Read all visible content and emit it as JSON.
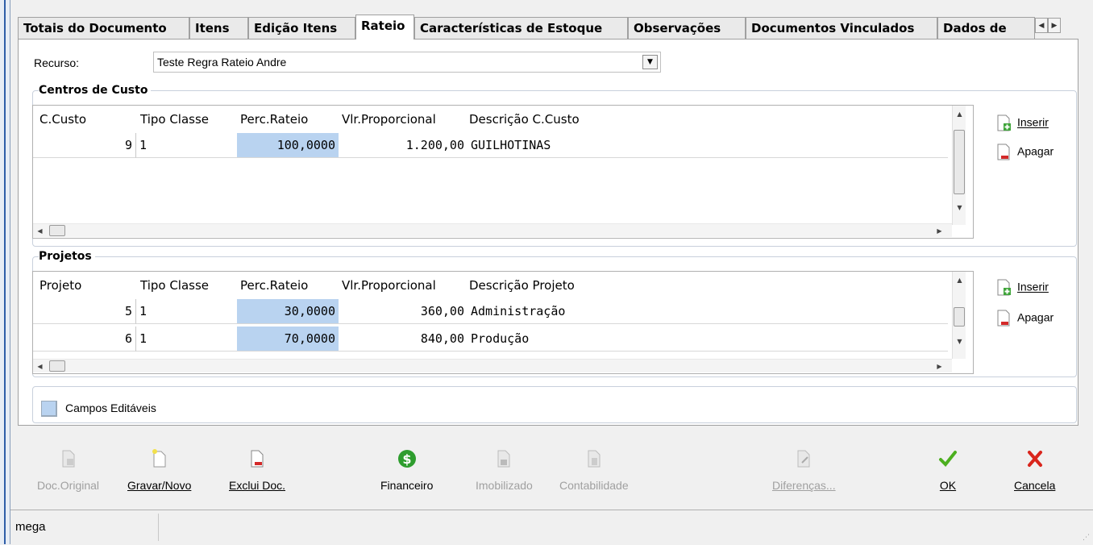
{
  "tabs": [
    {
      "label": "Totais do Documento",
      "active": false
    },
    {
      "label": "Itens",
      "active": false
    },
    {
      "label": "Edição Itens",
      "active": false
    },
    {
      "label": "Rateio",
      "active": true
    },
    {
      "label": "Características de Estoque",
      "active": false
    },
    {
      "label": "Observações",
      "active": false
    },
    {
      "label": "Documentos Vinculados",
      "active": false
    },
    {
      "label": "Dados de",
      "active": false
    }
  ],
  "recurso": {
    "label": "Recurso:",
    "value": "Teste Regra Rateio Andre"
  },
  "centros": {
    "title": "Centros de Custo",
    "columns": [
      "C.Custo",
      "Tipo Classe",
      "Perc.Rateio",
      "Vlr.Proporcional",
      "Descrição C.Custo"
    ],
    "rows": [
      {
        "code": "9",
        "tipo": "1",
        "perc": "100,0000",
        "valor": "1.200,00",
        "desc": "GUILHOTINAS"
      }
    ],
    "insert_label": "Inserir",
    "delete_label": "Apagar"
  },
  "projetos": {
    "title": "Projetos",
    "columns": [
      "Projeto",
      "Tipo Classe",
      "Perc.Rateio",
      "Vlr.Proporcional",
      "Descrição Projeto"
    ],
    "rows": [
      {
        "code": "5",
        "tipo": "1",
        "perc": "30,0000",
        "valor": "360,00",
        "desc": "Administração"
      },
      {
        "code": "6",
        "tipo": "1",
        "perc": "70,0000",
        "valor": "840,00",
        "desc": "Produção"
      }
    ],
    "insert_label": "Inserir",
    "delete_label": "Apagar"
  },
  "legend": {
    "label": "Campos Editáveis",
    "color": "#b9d3f0"
  },
  "toolbar": {
    "doc_original": "Doc.Original",
    "gravar_novo": "Gravar/Novo",
    "exclui_doc": "Exclui Doc.",
    "financeiro": "Financeiro",
    "imobilizado": "Imobilizado",
    "contabilidade": "Contabilidade",
    "diferencas": "Diferenças...",
    "ok": "OK",
    "cancela": "Cancela"
  },
  "status": {
    "user": "mega"
  },
  "colors": {
    "editable": "#b9d3f0",
    "ok": "#4caf1f",
    "cancel": "#d9251c",
    "money": "#2e9d2e"
  }
}
